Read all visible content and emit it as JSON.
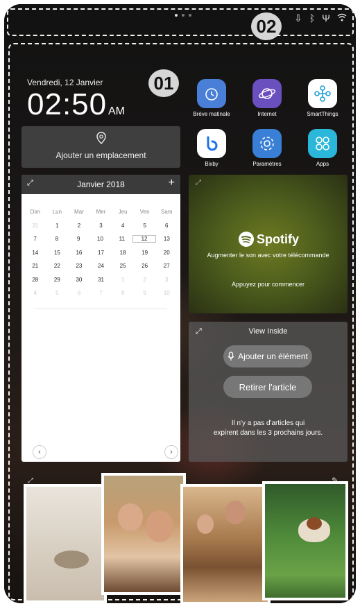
{
  "annotations": {
    "badge_main": "01",
    "badge_status": "02"
  },
  "status_bar": {
    "icons": [
      "download-icon",
      "bluetooth-icon",
      "usb-icon",
      "wifi-icon"
    ]
  },
  "clock": {
    "date": "Vendredi, 12 Janvier",
    "time": "02:50",
    "ampm": "AM"
  },
  "location": {
    "label": "Ajouter un emplacement",
    "icon": "location-pin-icon"
  },
  "apps": [
    {
      "label": "Brève matinale",
      "color": "#4a7fd8",
      "icon": "alarm-clock-icon"
    },
    {
      "label": "Internet",
      "color": "#6a4fbf",
      "icon": "planet-icon"
    },
    {
      "label": "SmartThings",
      "color": "#ffffff",
      "icon": "smartthings-icon"
    },
    {
      "label": "Bixby",
      "color": "#ffffff",
      "icon": "bixby-icon"
    },
    {
      "label": "Paramètres",
      "color": "#3a7fd6",
      "icon": "gear-icon"
    },
    {
      "label": "Apps",
      "color": "#2bb7d9",
      "icon": "apps-grid-icon"
    }
  ],
  "calendar": {
    "month": "Janvier 2018",
    "weekdays": [
      "Dim",
      "Lun",
      "Mar",
      "Mer",
      "Jeu",
      "Ven",
      "Sam"
    ],
    "weeks": [
      [
        "31",
        "1",
        "2",
        "3",
        "4",
        "5",
        "6"
      ],
      [
        "7",
        "8",
        "9",
        "10",
        "11",
        "12",
        "13"
      ],
      [
        "14",
        "15",
        "16",
        "17",
        "18",
        "19",
        "20"
      ],
      [
        "21",
        "22",
        "23",
        "24",
        "25",
        "26",
        "27"
      ],
      [
        "28",
        "29",
        "30",
        "31",
        "1",
        "2",
        "3"
      ],
      [
        "4",
        "5",
        "6",
        "7",
        "8",
        "9",
        "10"
      ]
    ],
    "today": "12"
  },
  "spotify": {
    "brand": "Spotify",
    "subtitle": "Augmenter le son avec votre télécommande",
    "action": "Appuyez pour commencer"
  },
  "view_inside": {
    "title": "View Inside",
    "add_label": "Ajouter un élément",
    "remove_label": "Retirer l'article",
    "message_line1": "Il n'y a pas d'articles qui",
    "message_line2": "expirent dans les 3 prochains jours."
  }
}
